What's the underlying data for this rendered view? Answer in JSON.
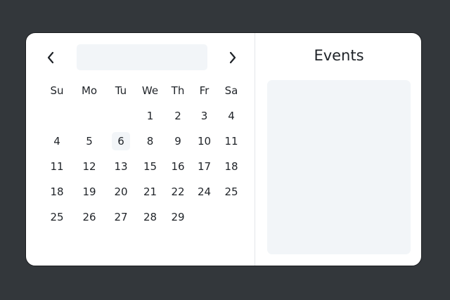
{
  "calendar": {
    "month_label": "",
    "weekdays": [
      "Su",
      "Mo",
      "Tu",
      "We",
      "Th",
      "Fr",
      "Sa"
    ],
    "weeks": [
      [
        "",
        "",
        "",
        "1",
        "2",
        "3",
        "4"
      ],
      [
        "4",
        "5",
        "6",
        "8",
        "9",
        "10",
        "11"
      ],
      [
        "11",
        "12",
        "13",
        "15",
        "16",
        "17",
        "18"
      ],
      [
        "18",
        "19",
        "20",
        "21",
        "22",
        "24",
        "25"
      ],
      [
        "25",
        "26",
        "27",
        "28",
        "29",
        "",
        ""
      ]
    ],
    "highlighted_day": "6"
  },
  "events": {
    "title": "Events"
  },
  "icons": {
    "prev": "chevron-left-icon",
    "next": "chevron-right-icon"
  },
  "colors": {
    "background": "#33373b",
    "card": "#ffffff",
    "highlight": "#f2f5f8",
    "text": "#1f2328"
  }
}
